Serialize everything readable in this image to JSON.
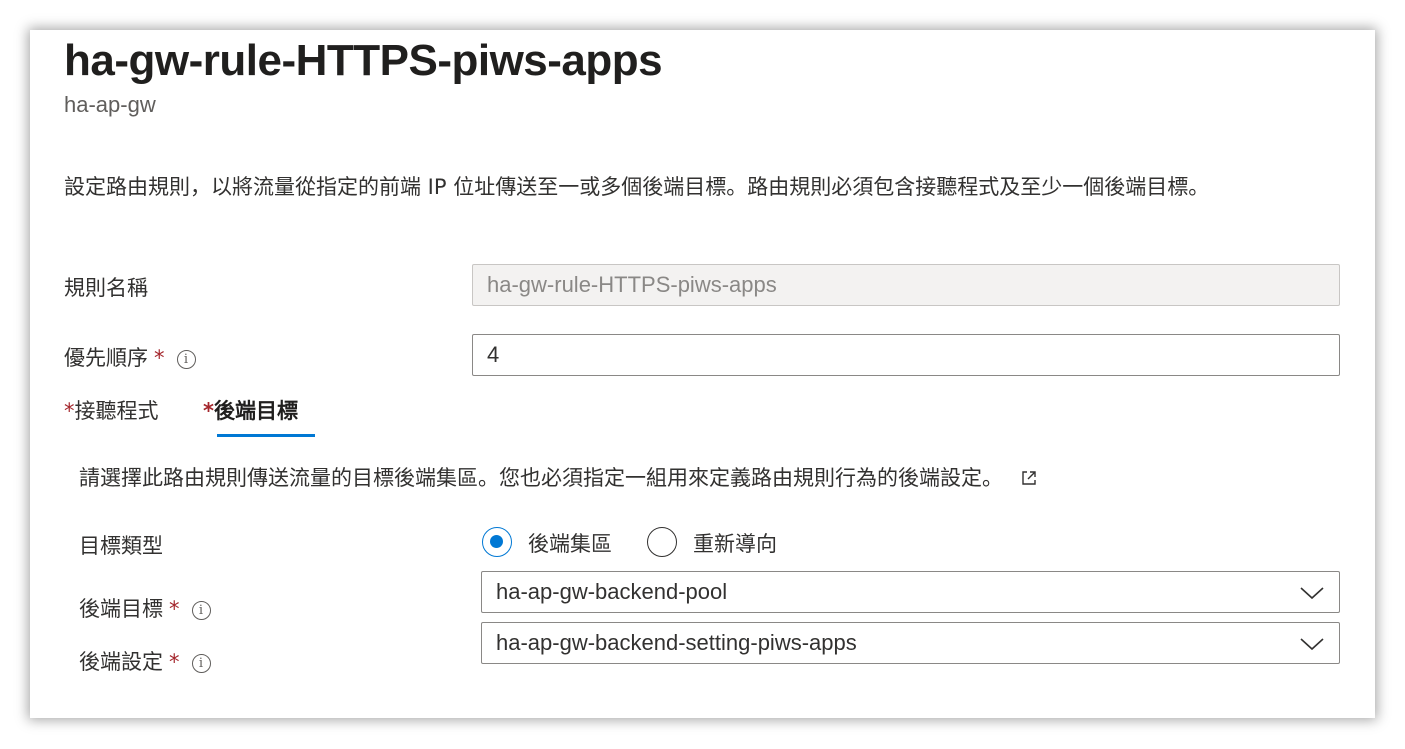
{
  "header": {
    "title": "ha-gw-rule-HTTPS-piws-apps",
    "subtitle": "ha-ap-gw"
  },
  "description": "設定路由規則，以將流量從指定的前端 IP 位址傳送至一或多個後端目標。路由規則必須包含接聽程式及至少一個後端目標。",
  "form": {
    "rule_name": {
      "label": "規則名稱",
      "value": "ha-gw-rule-HTTPS-piws-apps"
    },
    "priority": {
      "label": "優先順序",
      "required": "*",
      "info": "i",
      "value": "4"
    }
  },
  "tabs": [
    {
      "star": "*",
      "label": "接聽程式",
      "active": false
    },
    {
      "star": "*",
      "label": "後端目標",
      "active": true
    }
  ],
  "backend_tab": {
    "description": "請選擇此路由規則傳送流量的目標後端集區。您也必須指定一組用來定義路由規則行為的後端設定。",
    "target_type": {
      "label": "目標類型",
      "options": [
        {
          "label": "後端集區",
          "selected": true
        },
        {
          "label": "重新導向",
          "selected": false
        }
      ]
    },
    "backend_target": {
      "label": "後端目標",
      "required": "*",
      "info": "i",
      "value": "ha-ap-gw-backend-pool"
    },
    "backend_setting": {
      "label": "後端設定",
      "required": "*",
      "info": "i",
      "value": "ha-ap-gw-backend-setting-piws-apps"
    }
  },
  "icons": {
    "info": "info-circle-icon",
    "external_link": "external-link-icon",
    "dropdown": "chevron-down-icon"
  },
  "colors": {
    "accent": "#0078d4",
    "required": "#a4262c"
  }
}
